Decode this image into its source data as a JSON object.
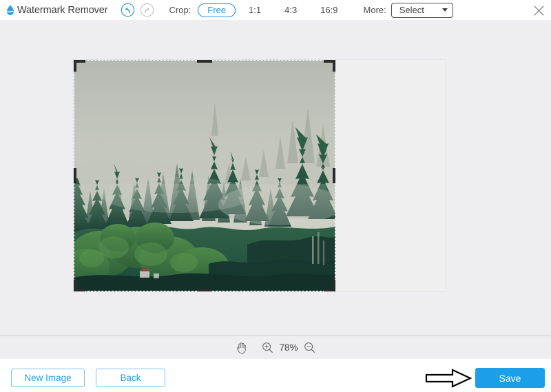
{
  "app": {
    "title": "Watermark Remover",
    "logo_icon": "water-drop-icon"
  },
  "toolbar": {
    "undo_icon": "undo-arrow-icon",
    "redo_icon": "redo-arrow-icon",
    "undo_enabled": true,
    "redo_enabled": false,
    "crop_label": "Crop:",
    "crop_ratios": [
      {
        "label": "Free",
        "active": true
      },
      {
        "label": "1:1",
        "active": false
      },
      {
        "label": "4:3",
        "active": false
      },
      {
        "label": "16:9",
        "active": false
      }
    ],
    "more_label": "More:",
    "more_select_value": "Select",
    "caret_icon": "chevron-down-icon",
    "close_icon": "close-icon",
    "accent_color": "#2a8fdd"
  },
  "canvas": {
    "image_alt": "misty-forest-photo",
    "crop_selection": {
      "style": "dashed",
      "handle_color": "#2b2b2b"
    }
  },
  "zoombar": {
    "hand_icon": "hand-tool-icon",
    "zoom_in_icon": "zoom-in-icon",
    "zoom_out_icon": "zoom-out-icon",
    "zoom_level": "78%"
  },
  "footer": {
    "new_image_label": "New Image",
    "back_label": "Back",
    "save_label": "Save",
    "save_color": "#1a9fe8",
    "outline_color": "#7ec1ec",
    "annotation_icon": "right-arrow-annotation"
  }
}
